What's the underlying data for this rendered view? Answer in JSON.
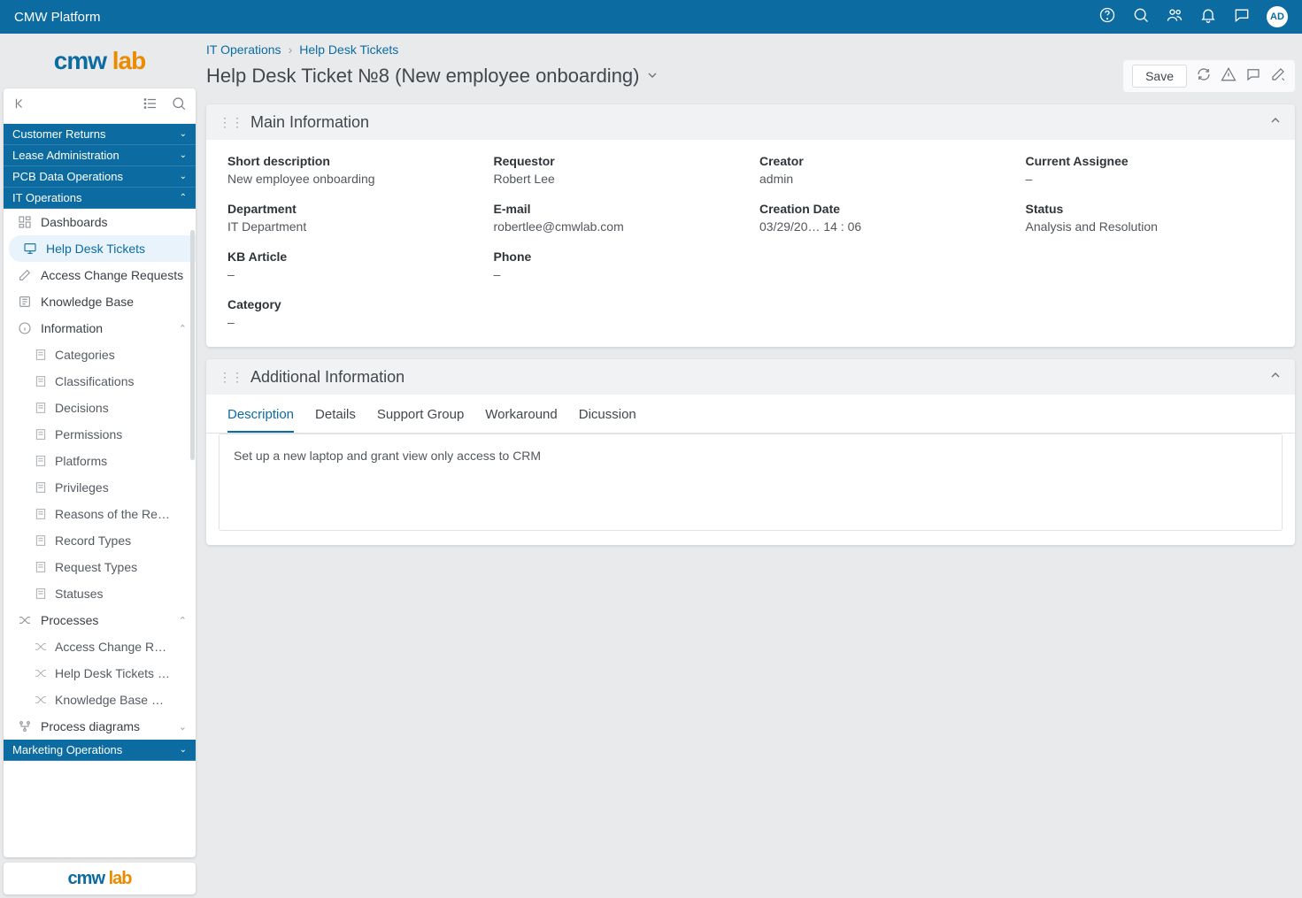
{
  "topbar": {
    "title": "CMW Platform",
    "avatar": "AD"
  },
  "logo": {
    "cmw": "cmw",
    "lab": "lab"
  },
  "footerLogo": {
    "cmw": "cmw",
    "lab": "lab"
  },
  "sidebar": {
    "sections": [
      {
        "label": "Customer Returns",
        "expanded": false
      },
      {
        "label": "Lease Administration",
        "expanded": false
      },
      {
        "label": "PCB Data Operations",
        "expanded": false
      },
      {
        "label": "IT Operations",
        "expanded": true
      },
      {
        "label": "Marketing Operations",
        "expanded": false
      }
    ],
    "it_ops_items": [
      {
        "label": "Dashboards",
        "active": false
      },
      {
        "label": "Help Desk Tickets",
        "active": true
      },
      {
        "label": "Access Change Requests",
        "active": false
      },
      {
        "label": "Knowledge Base",
        "active": false
      }
    ],
    "info_group": {
      "label": "Information",
      "items": [
        "Categories",
        "Classifications",
        "Decisions",
        "Permissions",
        "Platforms",
        "Privileges",
        "Reasons of the Requ…",
        "Record Types",
        "Request Types",
        "Statuses"
      ]
    },
    "processes_group": {
      "label": "Processes",
      "items": [
        "Access Change Requ…",
        "Help Desk Tickets Pr…",
        "Knowledge Base Ma…"
      ]
    },
    "diagrams_group": {
      "label": "Process diagrams"
    }
  },
  "breadcrumb": {
    "a": "IT Operations",
    "b": "Help Desk Tickets"
  },
  "page": {
    "title": "Help Desk Ticket №8 (New employee onboarding)",
    "save": "Save"
  },
  "mainInfo": {
    "title": "Main Information",
    "fields": {
      "short_desc_l": "Short description",
      "short_desc_v": "New employee onboarding",
      "requestor_l": "Requestor",
      "requestor_v": "Robert Lee",
      "creator_l": "Creator",
      "creator_v": "admin",
      "assignee_l": "Current Assignee",
      "assignee_v": "–",
      "dept_l": "Department",
      "dept_v": "IT Department",
      "email_l": "E-mail",
      "email_v": "robertlee@cmwlab.com",
      "cdate_l": "Creation Date",
      "cdate_v": "03/29/20…   14 : 06",
      "status_l": "Status",
      "status_v": "Analysis and Resolution",
      "kb_l": "KB Article",
      "kb_v": "–",
      "phone_l": "Phone",
      "phone_v": "–",
      "cat_l": "Category",
      "cat_v": "–"
    }
  },
  "addlInfo": {
    "title": "Additional Information",
    "tabs": [
      "Description",
      "Details",
      "Support Group",
      "Workaround",
      "Dicussion"
    ],
    "description": "Set up a new laptop and grant view only access to CRM"
  }
}
